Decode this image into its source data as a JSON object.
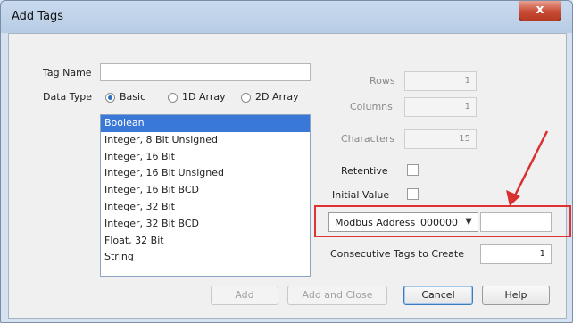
{
  "window": {
    "title": "Add Tags",
    "close_glyph": "x"
  },
  "form": {
    "tag_name_label": "Tag Name",
    "tag_name_value": "",
    "data_type_label": "Data Type",
    "data_type_options": [
      "Basic",
      "1D Array",
      "2D Array"
    ],
    "data_type_selected": "Basic",
    "types": [
      "Boolean",
      "Integer, 8 Bit Unsigned",
      "Integer, 16 Bit",
      "Integer, 16 Bit Unsigned",
      "Integer, 16 Bit BCD",
      "Integer, 32 Bit",
      "Integer, 32 Bit BCD",
      "Float, 32 Bit",
      "String"
    ],
    "selected_type": "Boolean",
    "rows_label": "Rows",
    "rows_value": "1",
    "columns_label": "Columns",
    "columns_value": "1",
    "characters_label": "Characters",
    "characters_value": "15",
    "retentive_label": "Retentive",
    "initial_value_label": "Initial Value",
    "modbus_label": "Modbus Address",
    "modbus_prefix": "000000",
    "modbus_value": "",
    "consecutive_label": "Consecutive Tags to Create",
    "consecutive_value": "1"
  },
  "buttons": {
    "add": "Add",
    "add_close": "Add and Close",
    "cancel": "Cancel",
    "help": "Help"
  },
  "annotation": {
    "arrow_color": "#d93030"
  }
}
